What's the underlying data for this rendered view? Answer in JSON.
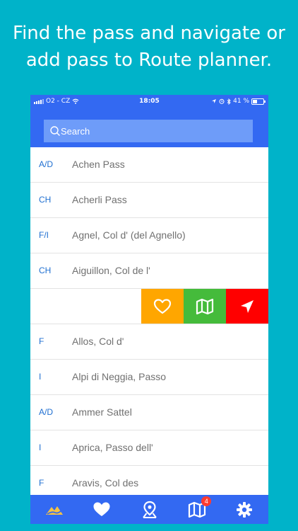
{
  "headline": {
    "line1": "Find the pass and navigate or",
    "line2": "add pass to Route planner."
  },
  "status_bar": {
    "carrier": "O2 - CZ",
    "time": "18:05",
    "battery": "41 %"
  },
  "search": {
    "placeholder": "Search"
  },
  "passes": [
    {
      "code": "A/D",
      "name": "Achen Pass"
    },
    {
      "code": "CH",
      "name": "Acherli Pass"
    },
    {
      "code": "F/I",
      "name": "Agnel, Col d' (del Agnello)"
    },
    {
      "code": "CH",
      "name": "Aiguillon, Col de l'"
    },
    {
      "code": "",
      "name": "",
      "swiped": true
    },
    {
      "code": "F",
      "name": "Allos, Col d'"
    },
    {
      "code": "I",
      "name": "Alpi di Neggia, Passo"
    },
    {
      "code": "A/D",
      "name": "Ammer Sattel"
    },
    {
      "code": "I",
      "name": "Aprica, Passo dell'"
    },
    {
      "code": "F",
      "name": "Aravis, Col des"
    }
  ],
  "swipe_actions": [
    {
      "icon": "heart-outline-icon",
      "color": "#ffa600"
    },
    {
      "icon": "map-icon",
      "color": "#45bb3b"
    },
    {
      "icon": "navigate-arrow-icon",
      "color": "#ff0000"
    }
  ],
  "tab_bar": {
    "tabs": [
      {
        "icon": "mountain-pass-icon",
        "active": true
      },
      {
        "icon": "heart-icon"
      },
      {
        "icon": "location-pin-icon"
      },
      {
        "icon": "route-map-icon",
        "badge": "4"
      },
      {
        "icon": "gear-icon"
      }
    ]
  },
  "colors": {
    "background": "#00b3c9",
    "primary": "#3369f2",
    "code_text": "#1f6fd1"
  }
}
